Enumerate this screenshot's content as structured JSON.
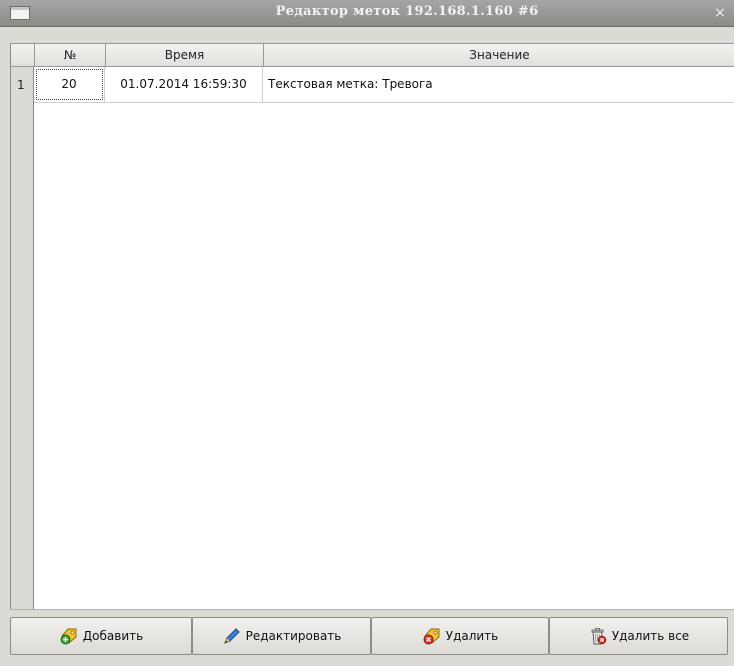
{
  "window": {
    "title": "Редактор меток 192.168.1.160 #6",
    "close_glyph": "×"
  },
  "table": {
    "columns": [
      "№",
      "Время",
      "Значение"
    ],
    "rows": [
      {
        "row_number": "1",
        "number": "20",
        "time": "01.07.2014 16:59:30",
        "value": "Текстовая метка: Тревога"
      }
    ]
  },
  "buttons": {
    "add": {
      "label": "Добавить",
      "icon": "tag-add-icon"
    },
    "edit": {
      "label": "Редактировать",
      "icon": "pencil-icon"
    },
    "delete": {
      "label": "Удалить",
      "icon": "tag-delete-icon"
    },
    "delete_all": {
      "label": "Удалить все",
      "icon": "trash-icon"
    }
  },
  "colors": {
    "titlebar": "#9a9896",
    "window_bg": "#dcdad5",
    "table_bg": "#ffffff"
  }
}
